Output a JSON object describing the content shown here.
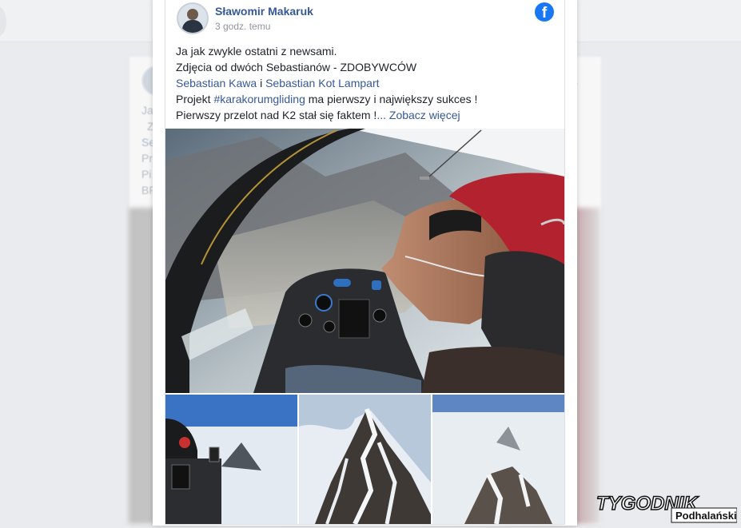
{
  "background": {
    "blurred_lines": [
      "Ja",
      "Z",
      "Se",
      "Pr",
      "Pi",
      "BR"
    ],
    "menu_dots": "..."
  },
  "post": {
    "author": "Sławomir Makaruk",
    "time": "3 godz. temu",
    "lines": {
      "line1": "Ja jak zwykle ostatni z newsami.",
      "line2": "Zdjęcia od dwóch Sebastianów - ZDOBYWCÓW",
      "mention1": "Sebastian Kawa",
      "conj": " i ",
      "mention2": "Sebastian Kot Lampart",
      "line4_prefix": "Projekt ",
      "hashtag": "#karakorumgliding",
      "line4_suffix": " ma pierwszy i największy sukces !",
      "line5": "Pierwszy przelot nad K2 stał się faktem !",
      "ellipsis": "...",
      "see_more": " Zobacz więcej"
    },
    "facebook_icon_glyph": "f",
    "images": [
      "glider-cockpit-pilot-photo",
      "cockpit-view-k2-photo",
      "k2-summit-photo",
      "k2-aerial-photo"
    ]
  },
  "watermark": {
    "brand_line1": "TYGODNIK",
    "brand_line2": "Podhalański"
  },
  "colors": {
    "link": "#365899",
    "facebook_blue": "#1877f2",
    "text": "#1d2129",
    "meta": "#90949c"
  }
}
